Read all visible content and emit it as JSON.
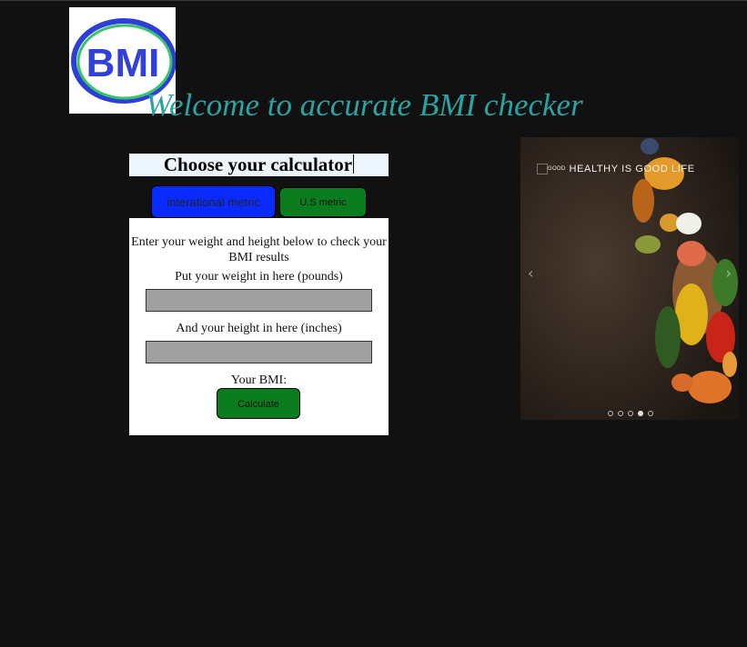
{
  "logo": {
    "text": "BMI"
  },
  "headline": "Welcome to accurate BMI checker",
  "calculator": {
    "title": "Choose your calculator",
    "tabs": [
      {
        "label": "interational metric",
        "color": "#0a2bff"
      },
      {
        "label": "U.S metric",
        "color": "#0b7d1e"
      }
    ],
    "instructions": "Enter your weight and height below to check your BMI results",
    "weight_label": "Put your weight in here (pounds)",
    "weight_value": "",
    "height_label": "And your height in here (inches)",
    "height_value": "",
    "result_label": "Your BMI:",
    "calculate_label": "Calculate"
  },
  "carousel": {
    "caption_small": "GOOD",
    "caption": "HEALTHY IS GOOD LIFE",
    "prev_icon": "chevron-left-icon",
    "next_icon": "chevron-right-icon",
    "slide_count": 5,
    "active_index": 3
  },
  "colors": {
    "background": "#111111",
    "headline": "#2aa3a3",
    "metric_button": "#0a2bff",
    "us_button": "#0b7d1e",
    "calculate_button": "#0b7d1e",
    "input_fill": "#a0a0a0"
  }
}
